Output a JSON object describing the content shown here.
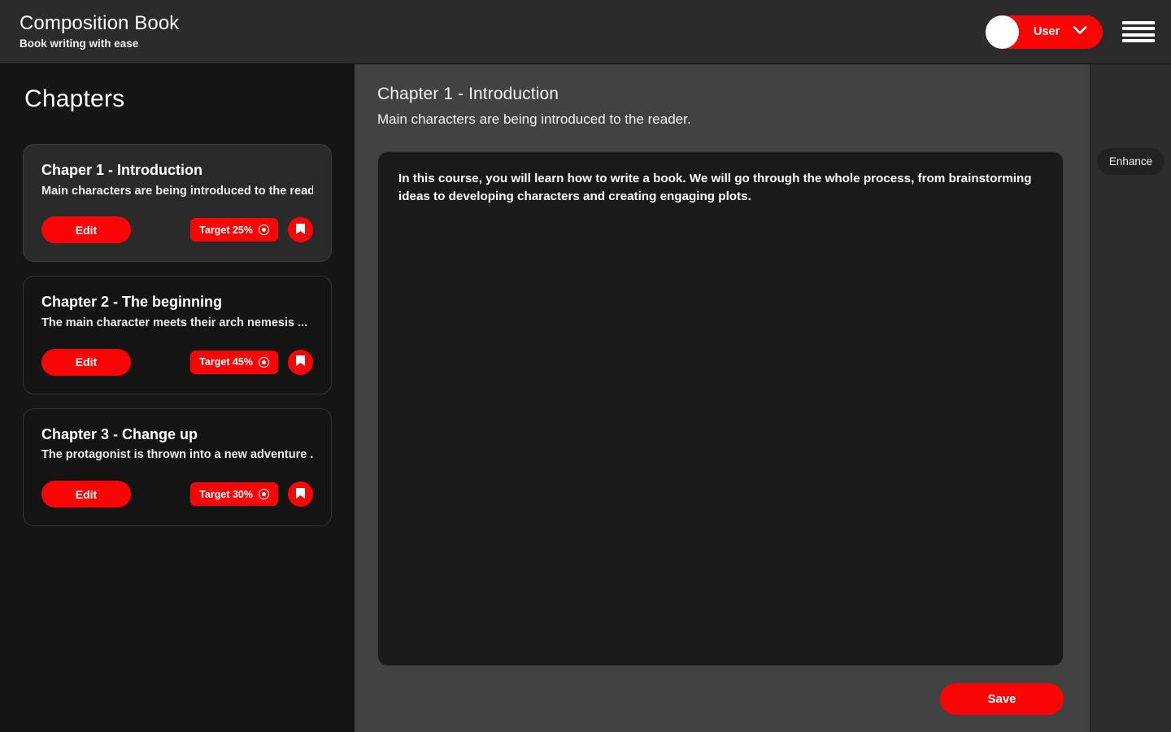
{
  "header": {
    "brand_title": "Composition Book",
    "brand_subtitle": "Book writing with ease",
    "user_label": "User",
    "chevron_icon": "chevron-down-icon",
    "menu_icon": "hamburger-menu-icon",
    "avatar_icon": "avatar"
  },
  "sidebar": {
    "title": "Chapters",
    "chapters": [
      {
        "name": "Chaper 1 - Introduction",
        "description": "Main characters are being introduced to the reader",
        "edit_label": "Edit",
        "target_label": "Target 25%",
        "target_icon": "target-icon",
        "bookmark_icon": "bookmark-icon",
        "active": true
      },
      {
        "name": "Chapter 2 - The beginning",
        "description": "The main character meets their arch nemesis ...",
        "edit_label": "Edit",
        "target_label": "Target 45%",
        "target_icon": "target-icon",
        "bookmark_icon": "bookmark-icon",
        "active": false
      },
      {
        "name": "Chapter 3 - Change up",
        "description": "The protagonist is thrown into a new adventure ...",
        "edit_label": "Edit",
        "target_label": "Target 30%",
        "target_icon": "target-icon",
        "bookmark_icon": "bookmark-icon",
        "active": false
      }
    ]
  },
  "main": {
    "title": "Chapter 1 - Introduction",
    "subtitle": "Main characters are being introduced to the reader.",
    "editor_text": "In this course, you will learn how to write a book. We will go through the whole process, from brainstorming ideas to developing characters and creating engaging plots.",
    "save_label": "Save"
  },
  "right_panel": {
    "enhance_label": "Enhance"
  },
  "colors": {
    "accent": "#fa0505",
    "header_bg": "#2b2b2b",
    "sidebar_bg": "#151515",
    "main_bg": "#424242",
    "editor_bg": "#1a1a1a",
    "card_bg": "#141414",
    "card_active_bg": "#2a2a2a",
    "right_panel_bg": "#2d2d2d",
    "text": "#ffffff"
  }
}
